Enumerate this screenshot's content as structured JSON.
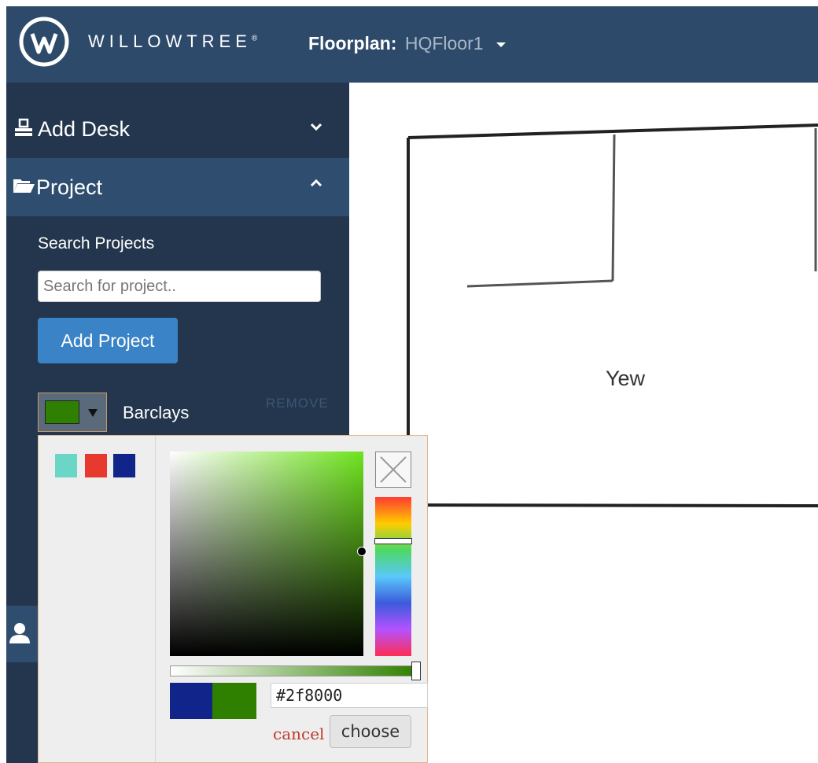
{
  "header": {
    "brand": "WILLOWTREE",
    "brand_mark": "®",
    "floorplan_label": "Floorplan:",
    "floorplan_value": "HQFloor1"
  },
  "sidebar": {
    "sections": [
      {
        "label": "Add Desk",
        "icon": "desk-icon",
        "state": "collapsed"
      },
      {
        "label": "Project",
        "icon": "folder-open-icon",
        "state": "expanded"
      }
    ],
    "search_title": "Search Projects",
    "search_placeholder": "Search for project..",
    "add_button": "Add Project",
    "projects": [
      {
        "name": "Barclays",
        "color": "#2f8000",
        "remove_label": "REMOVE"
      }
    ]
  },
  "color_picker": {
    "palette": [
      "#6bd5c6",
      "#e8392f",
      "#10248a"
    ],
    "previous_color": "#10248a",
    "current_color": "#2f8000",
    "hex_value": "#2f8000",
    "cancel_label": "cancel",
    "choose_label": "choose"
  },
  "map": {
    "room_label": "Yew"
  },
  "colors": {
    "navbar": "#2e4a6b",
    "sidebar": "#23364d",
    "section_active": "#2f4d6e",
    "primary_button": "#3a83c6"
  }
}
